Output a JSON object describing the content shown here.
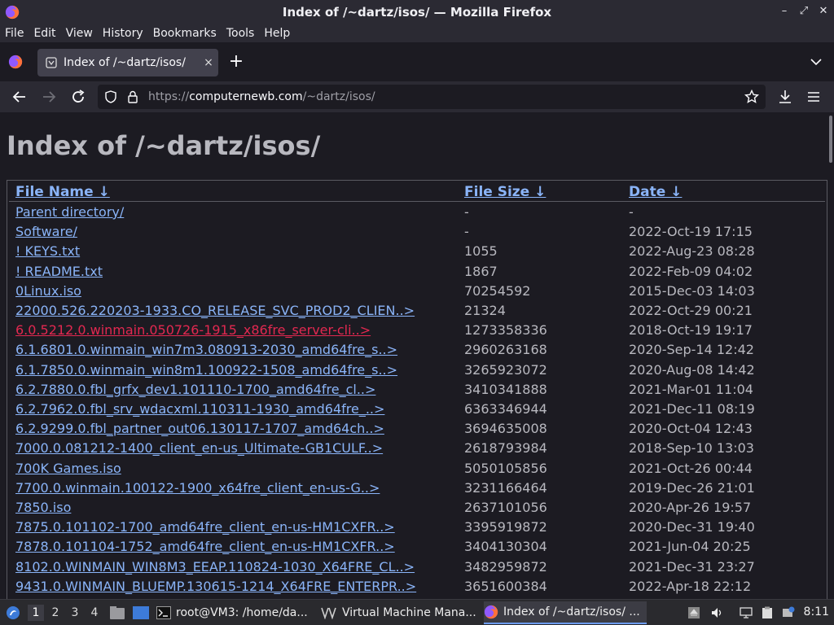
{
  "window": {
    "title": "Index of /~dartz/isos/ — Mozilla Firefox"
  },
  "menu": [
    "File",
    "Edit",
    "View",
    "History",
    "Bookmarks",
    "Tools",
    "Help"
  ],
  "tab": {
    "title": "Index of /~dartz/isos/",
    "close_label": "×",
    "new_tab_label": "+"
  },
  "url": {
    "prefix": "https://",
    "host": "computernewb.com",
    "path": "/~dartz/isos/"
  },
  "page": {
    "heading": "Index of /~dartz/isos/",
    "columns": {
      "name": "File Name  ↓",
      "size": "File Size  ↓",
      "date": "Date  ↓"
    },
    "rows": [
      {
        "name": "Parent directory/",
        "size": "-",
        "date": "-"
      },
      {
        "name": "Software/",
        "size": "-",
        "date": "2022-Oct-19 17:15"
      },
      {
        "name": "! KEYS.txt",
        "size": "1055",
        "date": "2022-Aug-23 08:28"
      },
      {
        "name": "! README.txt",
        "size": "1867",
        "date": "2022-Feb-09 04:02"
      },
      {
        "name": "0Linux.iso",
        "size": "70254592",
        "date": "2015-Dec-03 14:03"
      },
      {
        "name": "22000.526.220203-1933.CO_RELEASE_SVC_PROD2_CLIEN..>",
        "size": "21324",
        "date": "2022-Oct-29 00:21"
      },
      {
        "name": "6.0.5212.0.winmain.050726-1915_x86fre_server-cli..>",
        "size": "1273358336",
        "date": "2018-Oct-19 19:17",
        "visited": true
      },
      {
        "name": "6.1.6801.0.winmain_win7m3.080913-2030_amd64fre_s..>",
        "size": "2960263168",
        "date": "2020-Sep-14 12:42"
      },
      {
        "name": "6.1.7850.0.winmain_win8m1.100922-1508_amd64fre_s..>",
        "size": "3265923072",
        "date": "2020-Aug-08 14:42"
      },
      {
        "name": "6.2.7880.0.fbl_grfx_dev1.101110-1700_amd64fre_cl..>",
        "size": "3410341888",
        "date": "2021-Mar-01 11:04"
      },
      {
        "name": "6.2.7962.0.fbl_srv_wdacxml.110311-1930_amd64fre_..>",
        "size": "6363346944",
        "date": "2021-Dec-11 08:19"
      },
      {
        "name": "6.2.9299.0.fbl_partner_out06.130117-1707_amd64ch..>",
        "size": "3694635008",
        "date": "2020-Oct-04 12:43"
      },
      {
        "name": "7000.0.081212-1400_client_en-us_Ultimate-GB1CULF..>",
        "size": "2618793984",
        "date": "2018-Sep-10 13:03"
      },
      {
        "name": "700K Games.iso",
        "size": "5050105856",
        "date": "2021-Oct-26 00:44"
      },
      {
        "name": "7700.0.winmain.100122-1900_x64fre_client_en-us-G..>",
        "size": "3231166464",
        "date": "2019-Dec-26 21:01"
      },
      {
        "name": "7850.iso",
        "size": "2637101056",
        "date": "2020-Apr-26 19:57"
      },
      {
        "name": "7875.0.101102-1700_amd64fre_client_en-us-HM1CXFR..>",
        "size": "3395919872",
        "date": "2020-Dec-31 19:40"
      },
      {
        "name": "7878.0.101104-1752_amd64fre_client_en-us-HM1CXFR..>",
        "size": "3404130304",
        "date": "2021-Jun-04 20:25"
      },
      {
        "name": "8102.0.WINMAIN_WIN8M3_EEAP.110824-1030_X64FRE_CL..>",
        "size": "3482959872",
        "date": "2021-Dec-31 23:27"
      },
      {
        "name": "9431.0.WINMAIN_BLUEMP.130615-1214_X64FRE_ENTERPR..>",
        "size": "3651600384",
        "date": "2022-Apr-18 22:12"
      }
    ]
  },
  "taskbar": {
    "workspaces": [
      "1",
      "2",
      "3",
      "4"
    ],
    "items": [
      {
        "label": "root@VM3: /home/da..."
      },
      {
        "label": "Virtual Machine Mana..."
      },
      {
        "label": "Index of /~dartz/isos/ ..."
      }
    ],
    "clock": "8:11"
  },
  "colors": {
    "link": "#8ab4f8",
    "visited_link": "#e22850",
    "firefox_orange": "#ff7139",
    "firefox_purple": "#9059ff"
  }
}
